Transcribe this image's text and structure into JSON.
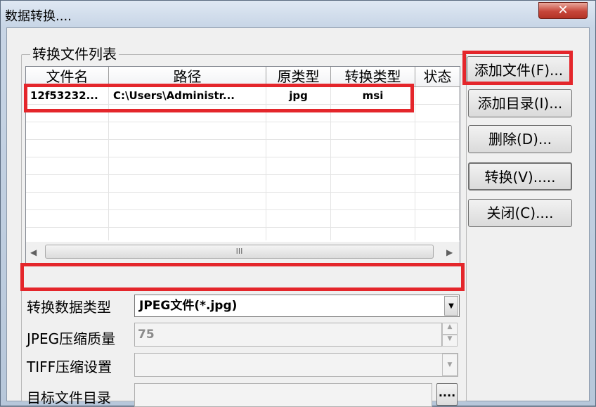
{
  "window": {
    "title": "数据转换....",
    "close_symbol": "✕"
  },
  "file_list": {
    "group_title": "转换文件列表",
    "columns": [
      "文件名",
      "路径",
      "原类型",
      "转换类型",
      "状态"
    ],
    "rows": [
      {
        "name": "12f53232...",
        "path": "C:\\Users\\Administr...",
        "src_type": "jpg",
        "dst_type": "msi",
        "status": ""
      }
    ],
    "scroll_left": "◀",
    "scroll_right": "▶",
    "scroll_grip": "III"
  },
  "buttons": {
    "add_file": "添加文件(F)...",
    "add_dir": "添加目录(I)...",
    "delete": "删除(D)...",
    "convert": "转换(V).....",
    "close": "关闭(C)...."
  },
  "form": {
    "convert_type_label": "转换数据类型",
    "convert_type_value": "JPEG文件(*.jpg)",
    "jpeg_quality_label": "JPEG压缩质量",
    "jpeg_quality_value": "75",
    "tiff_label": "TIFF压缩设置",
    "tiff_value": "",
    "target_dir_label": "目标文件目录",
    "target_dir_value": "",
    "browse_label": "...."
  },
  "colors": {
    "highlight": "#e4262b"
  }
}
